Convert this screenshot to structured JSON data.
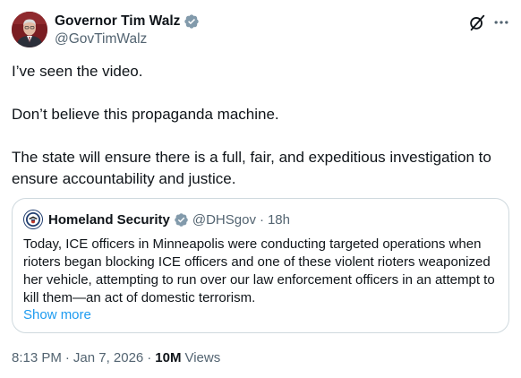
{
  "author": {
    "display_name": "Governor Tim Walz",
    "handle": "@GovTimWalz",
    "verified_icon": "verified-badge-icon",
    "avatar_colors": {
      "bg": "#7a1d22",
      "suit": "#2b2f3a",
      "skin": "#e2b9a3",
      "hair": "#d9d9d9"
    }
  },
  "tweet": {
    "paragraphs": [
      "I’ve seen the video.",
      "Don’t believe this propaganda machine.",
      "The state will ensure there is a full, fair, and expeditious investigation to ensure accountability and justice."
    ],
    "time": "8:13 PM",
    "date": "Jan 7, 2026",
    "views_count": "10M",
    "views_label": "Views"
  },
  "quoted": {
    "display_name": "Homeland Security",
    "handle": "@DHSgov",
    "time_ago": "18h",
    "avatar_icon": "dhs-seal-icon",
    "verified_icon": "government-verified-badge-icon",
    "text": "Today, ICE officers in Minneapolis were conducting targeted operations when rioters began blocking ICE officers and one of these violent rioters weaponized her vehicle, attempting to run over our law enforcement officers in an attempt to kill them—an act of domestic terrorism.",
    "show_more": "Show more"
  },
  "toolbar": {
    "grok_icon": "grok-icon",
    "more_icon": "more-options-icon"
  },
  "colors": {
    "text_primary": "#0f1419",
    "text_secondary": "#536471",
    "link": "#1d9bf0",
    "verified_blue": "#1d9bf0",
    "verified_gray": "#829aab",
    "border": "#cfd9de"
  }
}
